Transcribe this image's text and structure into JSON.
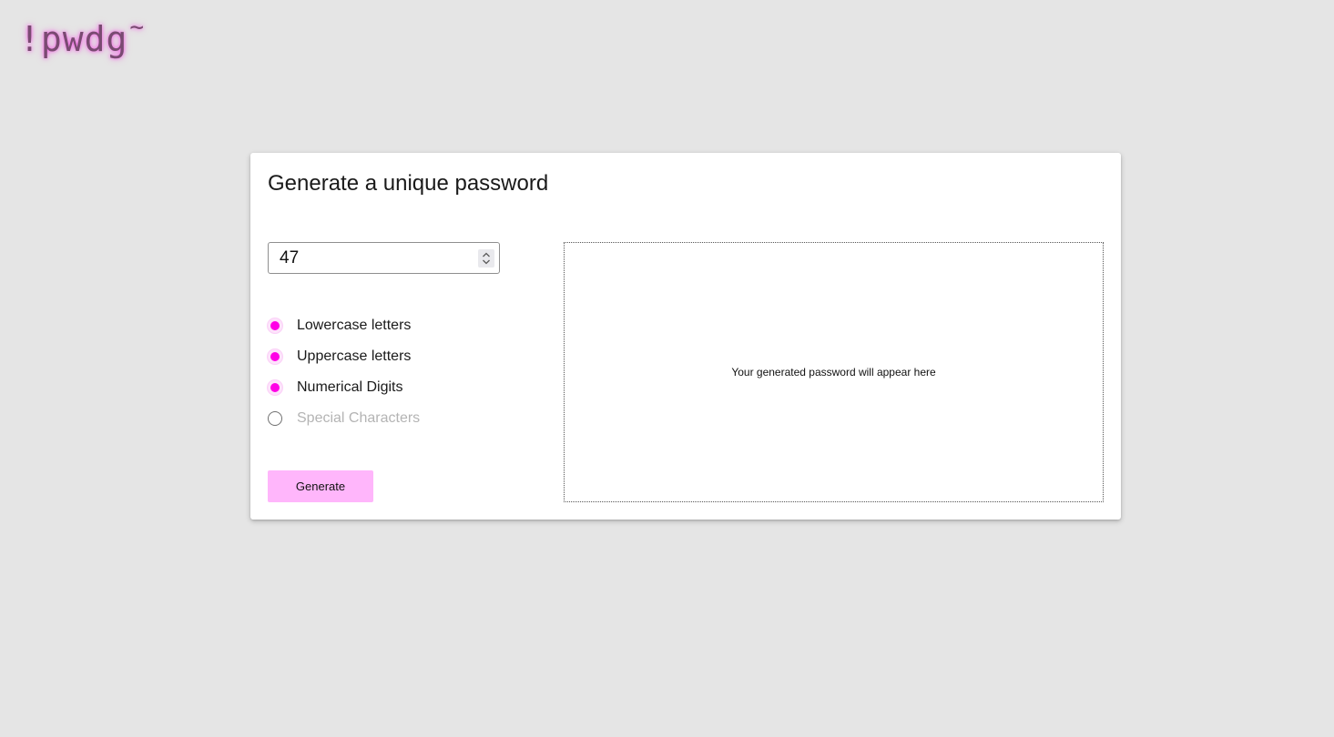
{
  "header": {
    "logo_main": "!pwdg",
    "logo_suffix": "~"
  },
  "card": {
    "title": "Generate a unique password",
    "length_value": "47",
    "options": [
      {
        "label": "Lowercase letters",
        "checked": true
      },
      {
        "label": "Uppercase letters",
        "checked": true
      },
      {
        "label": "Numerical Digits",
        "checked": true
      },
      {
        "label": "Special Characters",
        "checked": false
      }
    ],
    "generate_label": "Generate",
    "output_placeholder": "Your generated password will appear here"
  },
  "colors": {
    "background": "#e5e5e5",
    "accent": "#ff00e6",
    "button": "#ffb6fb",
    "logo": "#7a4a72"
  },
  "icons": {
    "spinner": "up-down-chevron-icon"
  }
}
